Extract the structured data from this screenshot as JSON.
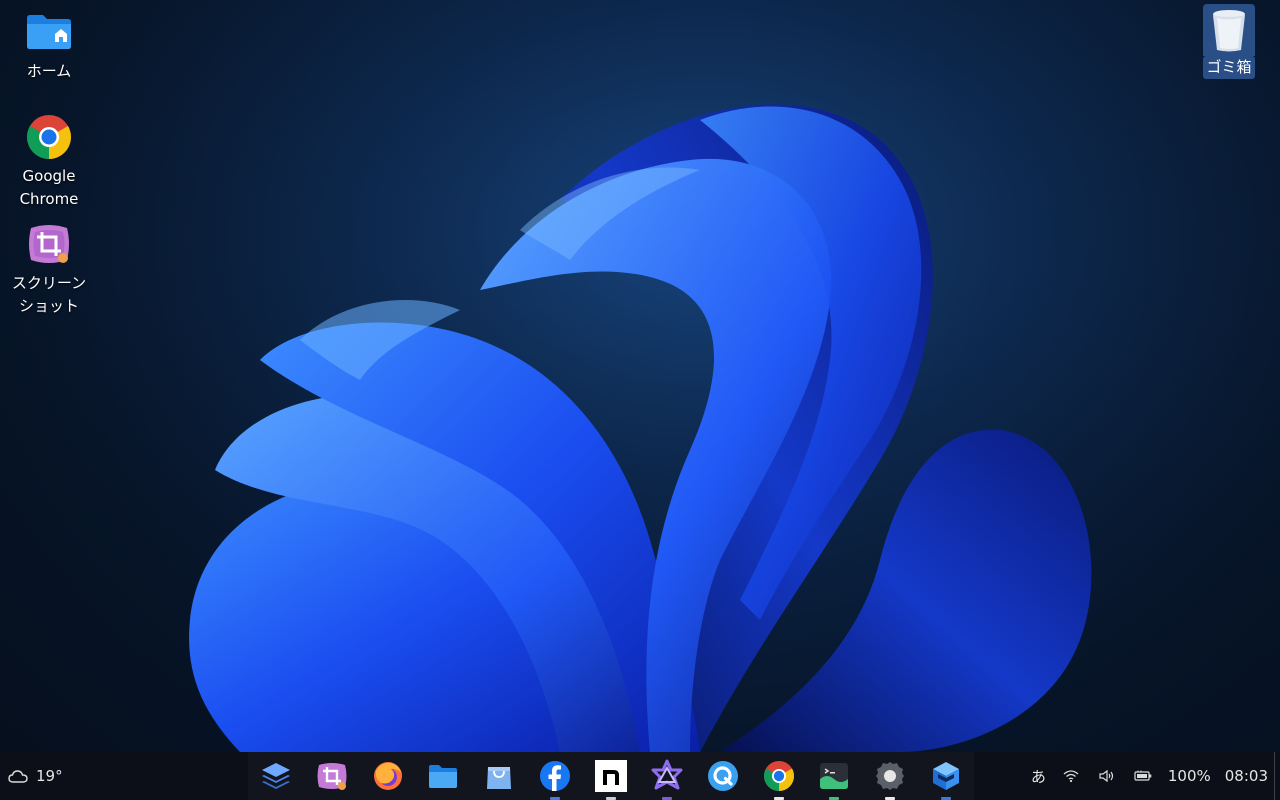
{
  "desktop": {
    "icons": [
      {
        "id": "home",
        "label": "ホーム",
        "icon": "folder-home-icon"
      },
      {
        "id": "chrome",
        "label": "Google Chrome",
        "icon": "chrome-icon"
      },
      {
        "id": "screenshot",
        "label": "スクリーンショット",
        "icon": "screenshot-crop-icon"
      },
      {
        "id": "trash",
        "label": "ゴミ箱",
        "icon": "trash-icon",
        "selected": true
      }
    ]
  },
  "taskbar": {
    "weather": {
      "icon": "cloud-icon",
      "temperature": "19°"
    },
    "dock": [
      {
        "name": "launcher",
        "icon": "layers-icon",
        "indicator": null
      },
      {
        "name": "screenshot",
        "icon": "screenshot-crop-icon",
        "indicator": null
      },
      {
        "name": "firefox",
        "icon": "firefox-icon",
        "indicator": null
      },
      {
        "name": "files",
        "icon": "folder-icon",
        "indicator": null
      },
      {
        "name": "store",
        "icon": "bag-icon",
        "indicator": null
      },
      {
        "name": "facebook",
        "icon": "facebook-icon",
        "indicator": "#4a7bd8"
      },
      {
        "name": "notion",
        "icon": "notion-icon",
        "indicator": "#cccccc"
      },
      {
        "name": "qt-creator",
        "icon": "star-icon",
        "indicator": "#7b5cd6"
      },
      {
        "name": "qbittorrent",
        "icon": "q-icon",
        "indicator": null
      },
      {
        "name": "chrome",
        "icon": "chrome-icon",
        "indicator": "#e8e8e8"
      },
      {
        "name": "terminal",
        "icon": "terminal-icon",
        "indicator": "#41c07a"
      },
      {
        "name": "settings",
        "icon": "gear-icon",
        "indicator": "#e8e8e8"
      },
      {
        "name": "stack",
        "icon": "cube-stack-icon",
        "indicator": "#3a7bd5"
      }
    ],
    "tray": {
      "ime": "あ",
      "wifi_icon": "wifi-icon",
      "volume_icon": "volume-icon",
      "battery_icon": "battery-icon",
      "battery": "100%",
      "time": "08:03"
    }
  },
  "colors": {
    "accent": "#2a4f86",
    "taskbar_bg": "#0c0f17"
  }
}
